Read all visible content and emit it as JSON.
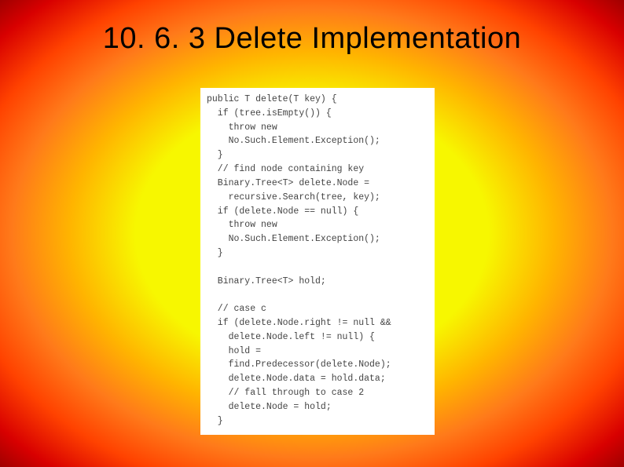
{
  "title": "10. 6. 3 Delete Implementation",
  "code": "public T delete(T key) {\n  if (tree.isEmpty()) {\n    throw new\n    No.Such.Element.Exception();\n  }\n  // find node containing key\n  Binary.Tree<T> delete.Node =\n    recursive.Search(tree, key);\n  if (delete.Node == null) {\n    throw new\n    No.Such.Element.Exception();\n  }\n\n  Binary.Tree<T> hold;\n\n  // case c\n  if (delete.Node.right != null &&\n    delete.Node.left != null) {\n    hold =\n    find.Predecessor(delete.Node);\n    delete.Node.data = hold.data;\n    // fall through to case 2\n    delete.Node = hold;\n  }"
}
